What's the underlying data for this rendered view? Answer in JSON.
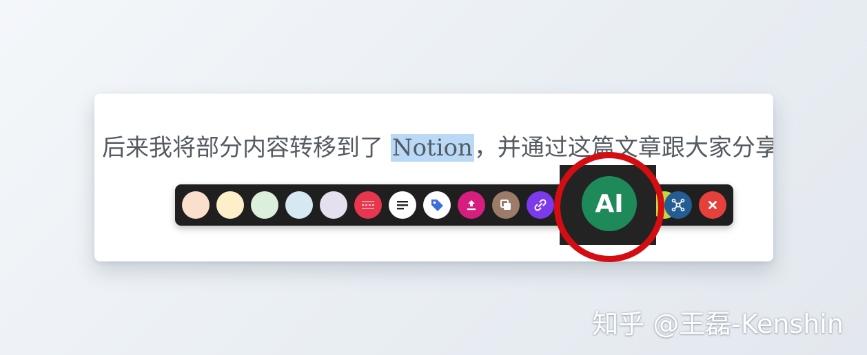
{
  "content": {
    "before": "后来我将部分内容转移到了 ",
    "selected": "Notion",
    "after": "，并通过这篇文章跟大家分享"
  },
  "toolbar": {
    "buttons": [
      {
        "name": "color-orange-button",
        "color": "#f9dfcc"
      },
      {
        "name": "color-yellow-button",
        "color": "#fcefc9"
      },
      {
        "name": "color-green-button",
        "color": "#dcefdd"
      },
      {
        "name": "color-blue-button",
        "color": "#d6e9f3"
      },
      {
        "name": "color-purple-button",
        "color": "#e4e0ee"
      },
      {
        "name": "strikethrough-button",
        "icon": "strikethrough-icon",
        "color": "#e8364f"
      },
      {
        "name": "text-format-button",
        "icon": "text-lines-icon",
        "color": "#ffffff"
      },
      {
        "name": "tag-button",
        "icon": "tag-icon",
        "color": "#ffffff"
      },
      {
        "name": "export-button",
        "icon": "upload-icon",
        "color": "#d61e7e"
      },
      {
        "name": "copy-button",
        "icon": "copy-icon",
        "color": "#9c7b69"
      },
      {
        "name": "link-button",
        "icon": "link-icon",
        "color": "#7c3aed"
      },
      {
        "name": "mindmap-button",
        "icon": "mindmap-icon",
        "color": "#245c94"
      },
      {
        "name": "close-button",
        "icon": "close-icon",
        "color": "#e5403a"
      }
    ],
    "ai_label": "AI",
    "ai_color": "#1e8a5a"
  },
  "annotation": {
    "ring_color": "#d40d12"
  },
  "watermark": "知乎 @王磊-Kenshin"
}
